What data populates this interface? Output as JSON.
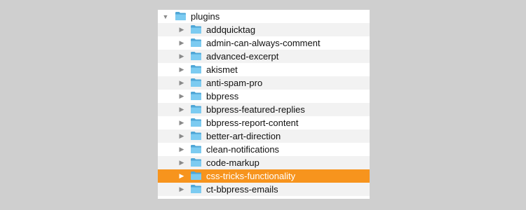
{
  "tree": {
    "root": {
      "label": "plugins",
      "icon": "folder-icon",
      "expanded": true
    },
    "items": [
      {
        "label": "addquicktag"
      },
      {
        "label": "admin-can-always-comment"
      },
      {
        "label": "advanced-excerpt"
      },
      {
        "label": "akismet"
      },
      {
        "label": "anti-spam-pro"
      },
      {
        "label": "bbpress"
      },
      {
        "label": "bbpress-featured-replies"
      },
      {
        "label": "bbpress-report-content"
      },
      {
        "label": "better-art-direction"
      },
      {
        "label": "clean-notifications"
      },
      {
        "label": "code-markup"
      },
      {
        "label": "css-tricks-functionality",
        "selected": true
      },
      {
        "label": "ct-bbpress-emails"
      }
    ]
  },
  "colors": {
    "background": "#cfcfcf",
    "selection": "#f7941d",
    "folder_fill": "#7ccbf1",
    "folder_edge": "#4ea6d6"
  }
}
